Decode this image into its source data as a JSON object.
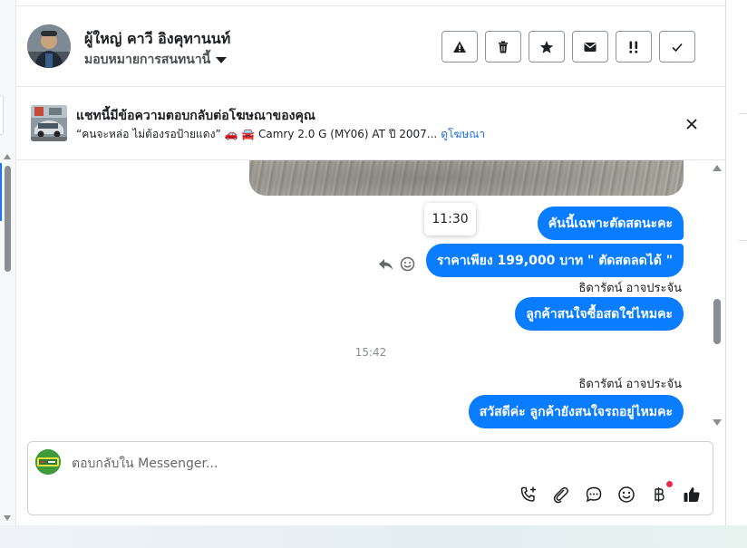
{
  "header": {
    "name": "ผู้ใหญ่ คาวี อิงคุทานนท์",
    "assignment": "มอบหมายการสนทนานี้",
    "actions": [
      {
        "icon": "warning-icon"
      },
      {
        "icon": "trash-icon"
      },
      {
        "icon": "star-icon"
      },
      {
        "icon": "envelope-icon"
      },
      {
        "icon": "priority-icon"
      },
      {
        "icon": "check-icon"
      }
    ]
  },
  "ad_banner": {
    "title": "แชทนี้มีข้อความตอบกลับต่อโฆษณาของคุณ",
    "description": "“คนจะหล่อ ไม่ต้องรอป้ายแดง” 🚗 🚘 Camry 2.0 G (MY06) AT ปี 2007...",
    "link": "ดูโฆษณา"
  },
  "messages": {
    "tooltip_time": "11:30",
    "bubble_1": "คันนี้เฉพาะตัดสดนะคะ",
    "bubble_2": "ราคาเพียง 199,000 บาท \" ตัดสดลดได้ \"",
    "sender_1": "ธิดารัตน์ อาจประจัน",
    "bubble_3": "ลูกค้าสนใจซื้อสดใช่ไหมคะ",
    "timestamp": "15:42",
    "sender_2": "ธิดารัตน์ อาจประจัน",
    "bubble_4": "สวัสดีค่ะ ลูกค้ายังสนใจรถอยู่ไหมคะ"
  },
  "composer": {
    "placeholder": "ตอบกลับใน Messenger...",
    "tools": [
      "phone-add-icon",
      "paperclip-icon",
      "chat-bubble-icon",
      "emoji-icon",
      "baht-icon",
      "thumbs-up-icon"
    ]
  },
  "colors": {
    "bubble": "#0a7cff",
    "link": "#216fdb",
    "notification_dot": "#f02849"
  }
}
